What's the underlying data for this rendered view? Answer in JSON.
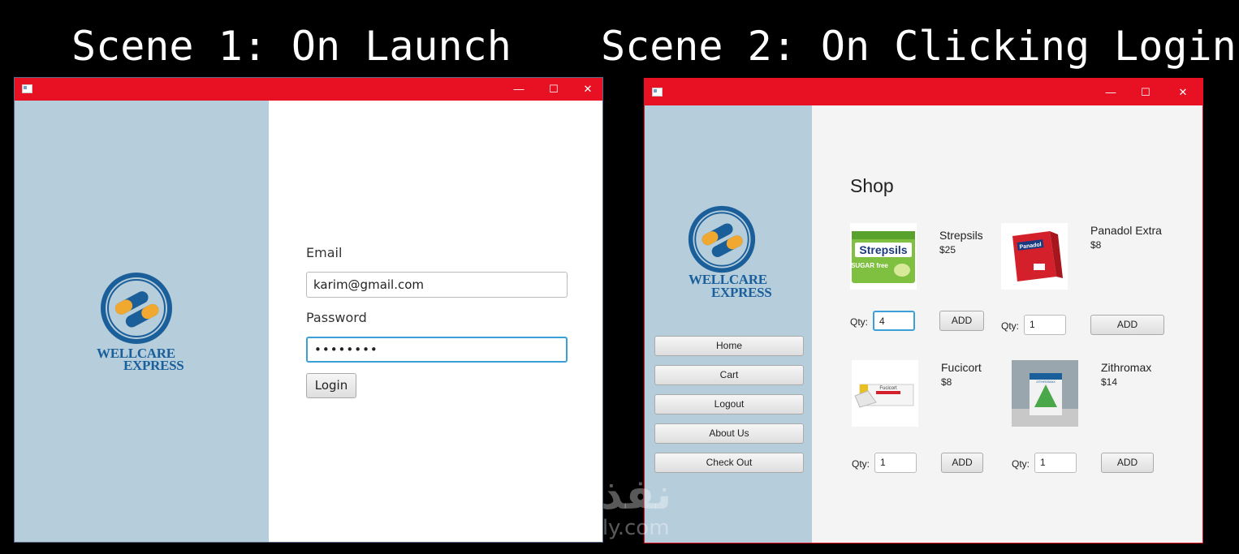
{
  "scene1": {
    "title": "Scene 1: On Launch"
  },
  "scene2": {
    "title": "Scene 2: On Clicking Login"
  },
  "window_controls": {
    "minimize": "—",
    "maximize": "☐",
    "close": "✕"
  },
  "logo": {
    "line1": "WELLCARE",
    "line2": "EXPRESS"
  },
  "login": {
    "email_label": "Email",
    "email_value": "karim@gmail.com",
    "password_label": "Password",
    "password_value": "••••••••",
    "login_button": "Login"
  },
  "nav": {
    "items": [
      {
        "label": "Home"
      },
      {
        "label": "Cart"
      },
      {
        "label": "Logout"
      },
      {
        "label": "About Us"
      },
      {
        "label": "Check Out"
      }
    ]
  },
  "shop": {
    "title": "Shop",
    "qty_label": "Qty:",
    "add_label": "ADD",
    "products": [
      {
        "name": "Strepsils",
        "price": "$25",
        "qty": "4",
        "image_text": "Strepsils",
        "image_sub": "SUGAR free"
      },
      {
        "name": "Panadol Extra",
        "price": "$8",
        "qty": "1",
        "image_text": "Panadol"
      },
      {
        "name": "Fucicort",
        "price": "$8",
        "qty": "1",
        "image_text": "Fucicort"
      },
      {
        "name": "Zithromax",
        "price": "$14",
        "qty": "1",
        "image_text": "ZITHROMAX"
      }
    ]
  },
  "watermark": {
    "arabic": "نفذلي",
    "latin": "nafezly.com"
  },
  "colors": {
    "titlebar": "#e81123",
    "sidebar": "#b6cddb",
    "logo_blue": "#1a5f9a",
    "capsule_orange": "#f0a830",
    "focus": "#3ca0d8"
  }
}
